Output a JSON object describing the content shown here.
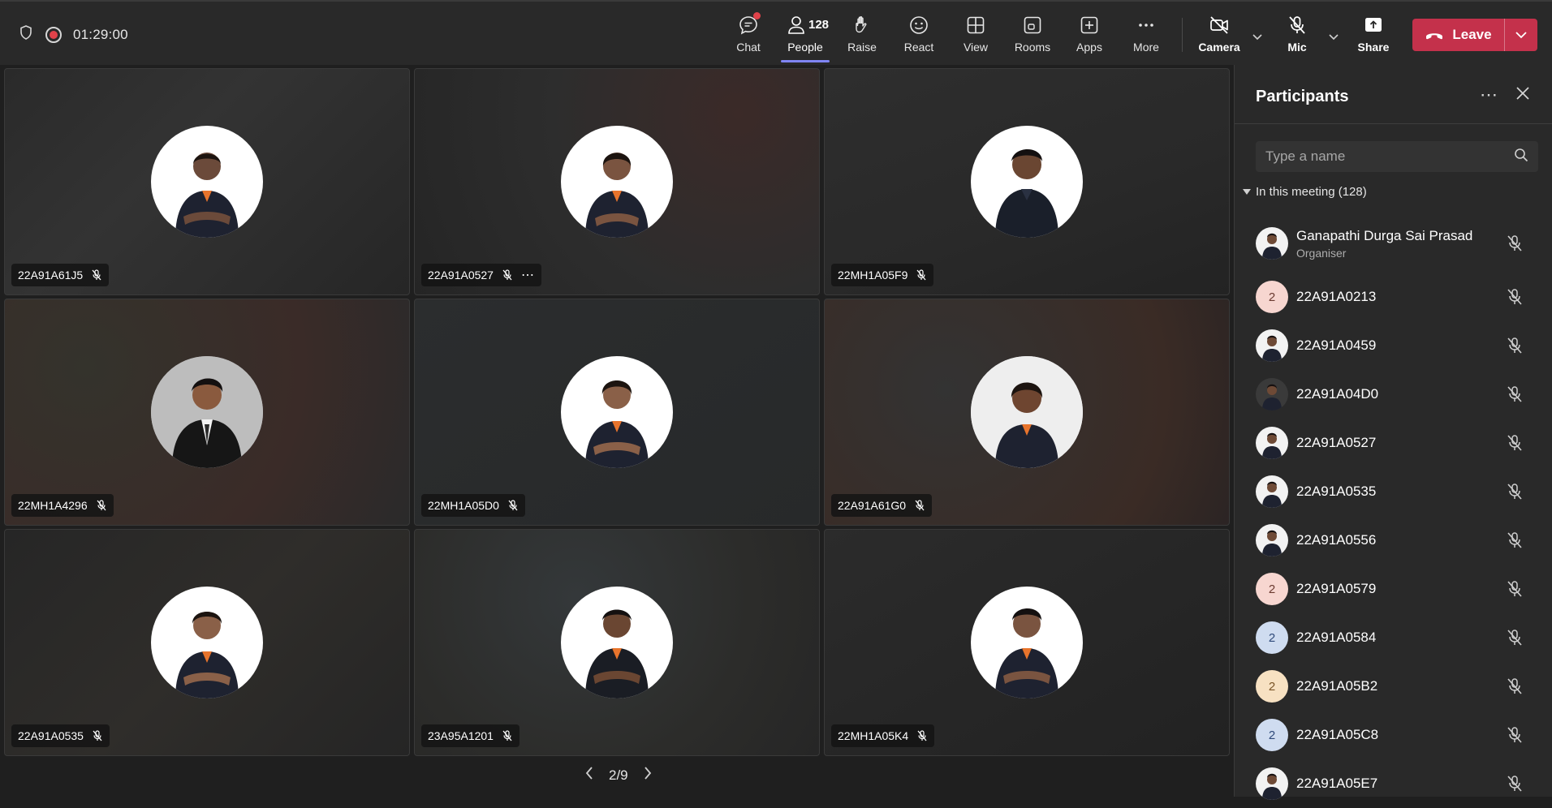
{
  "meeting": {
    "timer": "01:29:00"
  },
  "toolbar": {
    "chat": "Chat",
    "people": "People",
    "people_count": "128",
    "raise": "Raise",
    "react": "React",
    "view": "View",
    "rooms": "Rooms",
    "apps": "Apps",
    "more": "More",
    "camera": "Camera",
    "mic": "Mic",
    "share": "Share",
    "leave": "Leave"
  },
  "tiles": [
    {
      "name": "22A91A61J5"
    },
    {
      "name": "22A91A0527"
    },
    {
      "name": "22MH1A05F9"
    },
    {
      "name": "22MH1A4296"
    },
    {
      "name": "22MH1A05D0"
    },
    {
      "name": "22A91A61G0"
    },
    {
      "name": "22A91A0535"
    },
    {
      "name": "23A95A1201"
    },
    {
      "name": "22MH1A05K4"
    }
  ],
  "pager": {
    "label": "2/9"
  },
  "panel": {
    "title": "Participants",
    "search_placeholder": "Type a name",
    "section": "In this meeting (128)",
    "participants": [
      {
        "name": "Ganapathi Durga Sai Prasad",
        "role": "Organiser"
      },
      {
        "name": "22A91A0213",
        "initial": "2"
      },
      {
        "name": "22A91A0459"
      },
      {
        "name": "22A91A04D0"
      },
      {
        "name": "22A91A0527"
      },
      {
        "name": "22A91A0535"
      },
      {
        "name": "22A91A0556"
      },
      {
        "name": "22A91A0579",
        "initial": "2"
      },
      {
        "name": "22A91A0584",
        "initial": "2"
      },
      {
        "name": "22A91A05B2",
        "initial": "2"
      },
      {
        "name": "22A91A05C8",
        "initial": "2"
      },
      {
        "name": "22A91A05E7"
      }
    ]
  },
  "colors": {
    "accent": "#7f85f5",
    "leave": "#c4314b",
    "recording": "#e0424a"
  }
}
